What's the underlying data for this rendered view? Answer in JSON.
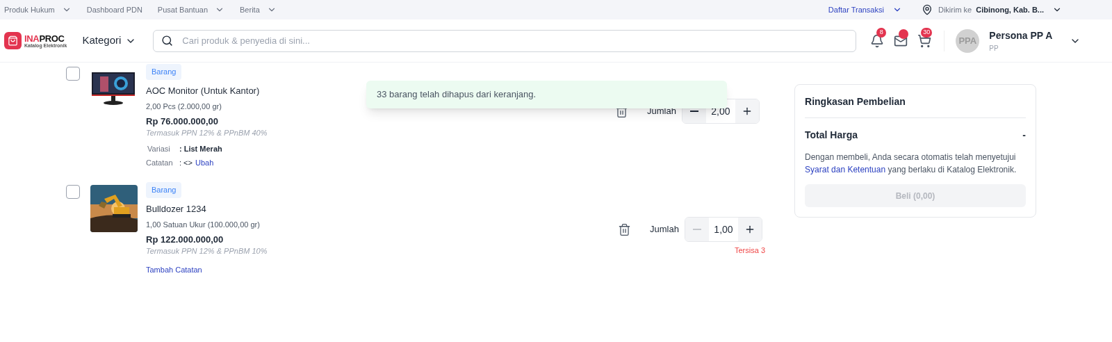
{
  "top_links": [
    {
      "label": "Produk Hukum",
      "dropdown": true
    },
    {
      "label": "Dashboard PDN",
      "dropdown": false
    },
    {
      "label": "Pusat Bantuan",
      "dropdown": true
    },
    {
      "label": "Berita",
      "dropdown": true
    }
  ],
  "transactions_link": "Daftar Transaksi",
  "delivery": {
    "label": "Dikirim ke",
    "location": "Cibinong, Kab. B..."
  },
  "logo": {
    "part_1": "INA",
    "part_2": "PROC",
    "subtitle": "Katalog Elektronik"
  },
  "category_button": "Kategori",
  "search": {
    "placeholder": "Cari produk & penyedia di sini..."
  },
  "notifications": {
    "count": "8"
  },
  "messages": {
    "unread": true
  },
  "cart": {
    "count": "30"
  },
  "user": {
    "initials": "PPA",
    "name": "Persona PP A",
    "role": "PP"
  },
  "items": [
    {
      "checked": false,
      "tag": "Barang",
      "name": "AOC Monitor (Untuk Kantor)",
      "unit": "2,00 Pcs (2.000,00 gr)",
      "price": "Rp 76.000.000,00",
      "tax_note": "Termasuk PPN 12% & PPnBM 40%",
      "variation_label": "Variasi",
      "variation_value": ": List Merah",
      "note_label": "Catatan",
      "note_value": ": <>",
      "note_link": "Ubah",
      "quantity_label": "Jumlah",
      "quantity": "2,00",
      "minus_disabled": false
    },
    {
      "checked": false,
      "tag": "Barang",
      "name": "Bulldozer 1234",
      "unit": "1,00 Satuan Ukur (100.000,00 gr)",
      "price": "Rp 122.000.000,00",
      "tax_note": "Termasuk PPN 12% & PPnBM 10%",
      "note_link": "Tambah Catatan",
      "quantity_label": "Jumlah",
      "quantity": "1,00",
      "minus_disabled": true,
      "stock_note": "Tersisa 3"
    }
  ],
  "toast": "33 barang telah dihapus dari keranjang.",
  "summary": {
    "title": "Ringkasan Pembelian",
    "total_label": "Total Harga",
    "total_value": "-",
    "agreement_before": "Dengan membeli, Anda secara otomatis telah menyetujui",
    "agreement_link": "Syarat dan Ketentuan",
    "agreement_after": "yang berlaku di Katalog Elektronik.",
    "buy_button": "Beli (0,00)",
    "buy_disabled": true
  }
}
